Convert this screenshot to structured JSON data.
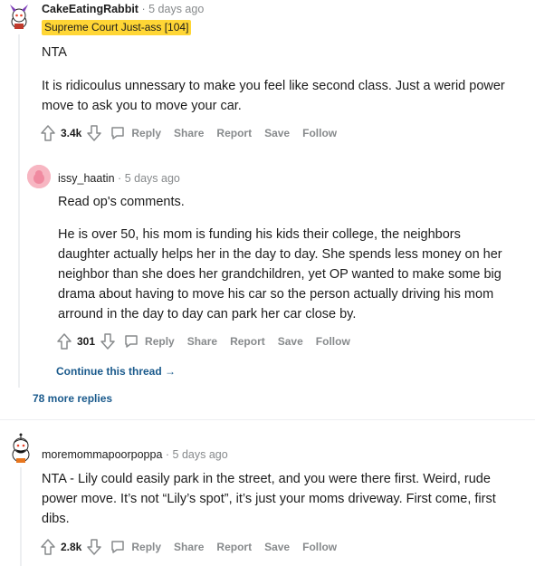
{
  "comments": [
    {
      "author": "CakeEatingRabbit",
      "time": "5 days ago",
      "flair": "Supreme Court Just-ass [104]",
      "paragraphs": [
        "NTA",
        "It is ridicoulus unnessary to make you feel like second class. Just a werid power move to ask you to move your car."
      ],
      "votes": "3.4k"
    },
    {
      "author": "issy_haatin",
      "time": "5 days ago",
      "paragraphs": [
        "Read op's comments.",
        "He is over 50, his mom is funding his kids their college, the neighbors daughter actually helps her in the day to day. She spends less money on her neighbor than she does her grandchildren, yet OP wanted to make some big drama about having to move his car so the person actually driving his mom arround in the day to day can park her car close by."
      ],
      "votes": "301"
    },
    {
      "author": "moremommapoorpoppa",
      "time": "5 days ago",
      "paragraphs": [
        "NTA - Lily could easily park in the street, and you were there first. Weird, rude power move. It’s not “Lily’s spot”, it’s just your moms driveway. First come, first dibs."
      ],
      "votes": "2.8k"
    }
  ],
  "actions": {
    "reply": "Reply",
    "share": "Share",
    "report": "Report",
    "save": "Save",
    "follow": "Follow"
  },
  "continue_thread": "Continue this thread →",
  "more_replies": "78 more replies",
  "separator": "·",
  "colors": {
    "flair_bg": "#ffd635",
    "meta_gray": "#878a8c",
    "link_blue": "#1a5a8c"
  }
}
